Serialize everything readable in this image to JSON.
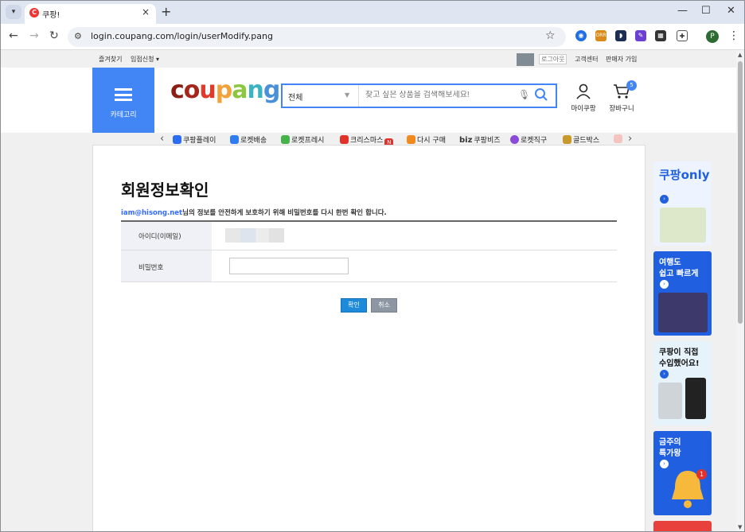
{
  "browser": {
    "tab_title": "쿠팡!",
    "tab_favicon_letter": "C",
    "url": "login.coupang.com/login/userModify.pang",
    "profile_initial": "P",
    "ext_label": "ORR"
  },
  "topbar": {
    "favorites": "즐겨찾기",
    "seller_apply": "입점신청 ▾",
    "logout": "로그아웃",
    "customer_center": "고객센터",
    "seller_join": "판매자 가입"
  },
  "header": {
    "category_label": "카테고리",
    "search_category": "전체",
    "search_placeholder": "찾고 싶은 상품을 검색해보세요!",
    "mycoupang": "마이쿠팡",
    "cart": "장바구니",
    "cart_count": "5",
    "menu": [
      {
        "label": "쿠팡플레이",
        "color": "#2b6cf3"
      },
      {
        "label": "로켓배송",
        "color": "#2f7df0"
      },
      {
        "label": "로켓프레시",
        "color": "#46b24a"
      },
      {
        "label": "크리스마스",
        "color": "#e0322b"
      },
      {
        "label": "다시 구매",
        "color": "#f08a1e"
      },
      {
        "label": "쿠팡비즈",
        "color": "#444444"
      },
      {
        "label": "로켓직구",
        "color": "#8a4bd9"
      },
      {
        "label": "골드박스",
        "color": "#c99a2b"
      }
    ],
    "menu_new_badge": "N",
    "biz_prefix": "biz"
  },
  "form": {
    "title": "회원정보확인",
    "email": "iam@hisong.net",
    "desc_rest": "님의 정보를 안전하게 보호하기 위해 비밀번호를 다시 한번 확인 합니다.",
    "id_label": "아이디(이메일)",
    "pw_label": "비밀번호",
    "confirm": "확인",
    "cancel": "취소"
  },
  "ads": [
    {
      "text": "쿠팡only",
      "bg": "#eef4ff",
      "color": "#1f5fe0"
    },
    {
      "text": "여행도\n쉽고 빠르게",
      "bg": "#1f5fe0",
      "color": "#ffffff"
    },
    {
      "text": "쿠팡이 직접\n수입했어요!",
      "bg": "#e7f3fb",
      "color": "#111111"
    },
    {
      "text": "금주의\n특가왕",
      "bg": "#1f5fe0",
      "color": "#ffffff"
    }
  ],
  "ad_bell_count": "1"
}
